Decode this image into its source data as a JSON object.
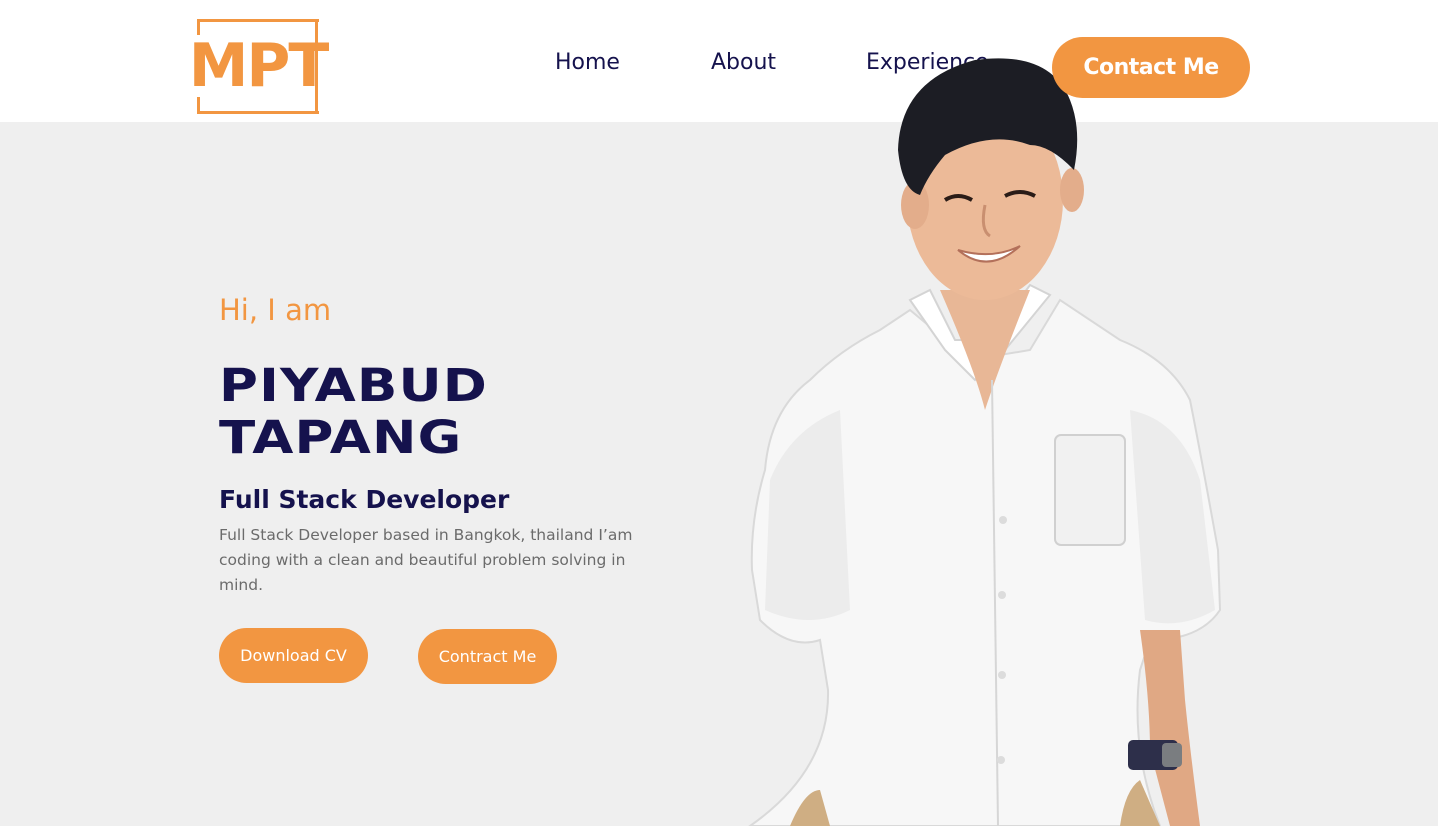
{
  "nav": {
    "logo_text": "MPT",
    "links": [
      {
        "label": "Home"
      },
      {
        "label": "About"
      },
      {
        "label": "Experience"
      }
    ],
    "contact_label": "Contact Me"
  },
  "hero": {
    "greeting": "Hi, I am",
    "first_name": "PIYABUD",
    "last_name": "TAPANG",
    "role": "Full Stack Developer",
    "bio": "Full Stack Developer based in Bangkok, thailand I’am coding with a clean and beautiful problem solving in mind.",
    "download_cv_label": "Download CV",
    "contract_me_label": "Contract Me"
  },
  "colors": {
    "accent": "#f29641",
    "navy": "#15124d",
    "hero_bg": "#efefef",
    "body_text": "#6b6b6b"
  },
  "icons": {
    "portrait": "person-photo"
  }
}
